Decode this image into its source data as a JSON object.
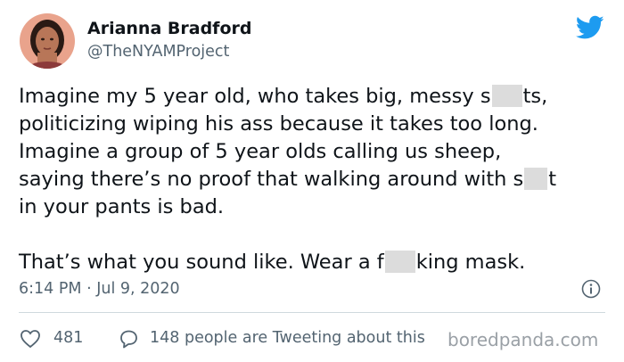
{
  "author": {
    "name": "Arianna Bradford",
    "handle": "@TheNYAMProject"
  },
  "tweet": {
    "line1_before": "Imagine my 5 year old, who takes big, messy s",
    "line1_after": "ts,",
    "line2": "politicizing wiping his ass because it takes too long.",
    "line3": "Imagine a group of 5 year olds calling us sheep,",
    "line4_before": "saying there’s no proof that walking around with s",
    "line4_after": "t",
    "line5": "in your pants is bad.",
    "line6_before": "That’s what you sound like. Wear a f",
    "line6_after": "king mask."
  },
  "meta": {
    "timestamp": "6:14 PM · Jul 9, 2020"
  },
  "actions": {
    "like_count": "481",
    "reply_text": "148 people are Tweeting about this"
  },
  "watermark": "boredpanda.com",
  "colors": {
    "twitter_blue": "#1d9bf0",
    "text": "#0f1419",
    "secondary": "#536471",
    "censor_box": "#dcdcdc"
  },
  "icons": [
    "avatar",
    "twitter-bird-icon",
    "info-icon",
    "heart-icon",
    "speech-bubble-icon"
  ]
}
